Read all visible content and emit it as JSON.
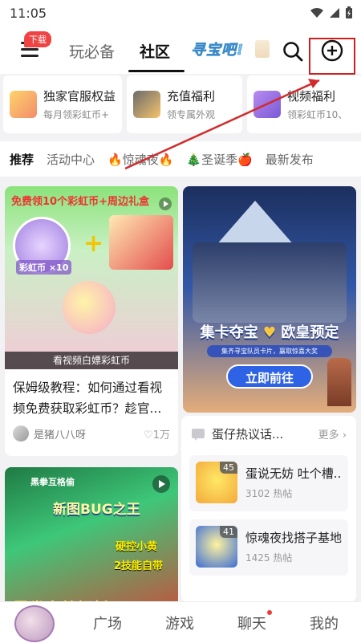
{
  "status_bar": {
    "time": "11:05"
  },
  "top_nav": {
    "download_badge": "下载",
    "tabs": [
      "玩必备",
      "社区"
    ],
    "logo_text": "寻宝吧!"
  },
  "cards": [
    {
      "title": "独家官服权益",
      "subtitle": "每月领彩虹币+"
    },
    {
      "title": "充值福利",
      "subtitle": "领专属外观"
    },
    {
      "title": "视频福利",
      "subtitle": "领彩虹币10、"
    }
  ],
  "sub_tabs": [
    "推荐",
    "活动中心",
    "🔥惊魂夜🔥",
    "🎄圣诞季🍎",
    "最新发布"
  ],
  "feed": {
    "post1": {
      "banner": "免费领10个彩虹币+周边礼盒",
      "coin_label": "彩虹币 ×10",
      "caption": "看视频白嫖彩虹币",
      "title": "保姆级教程：如何通过看视频免费获取彩虹币？趁官...",
      "author": "是猪八八呀",
      "likes": "♡1万"
    },
    "post2": {
      "headline": "集卡夺宝",
      "headline2": "欧皇预定",
      "subline": "集齐寻宝队员卡片，赢取惊喜大奖",
      "cta": "立即前往"
    },
    "post3": {
      "label": "黑拳互格偷",
      "headline": "新图BUG之王",
      "side1": "硬控小黄",
      "side2": "2技能自带",
      "bottom": "黑拳实战解析"
    },
    "discussion": {
      "title": "蛋仔热议话...",
      "more": "更多 ›",
      "topics": [
        {
          "count": "45",
          "title": "蛋说无妨 吐个槽...",
          "sub": "3102 热帖"
        },
        {
          "count": "41",
          "title": "惊魂夜找搭子基地",
          "sub": "1425 热帖"
        }
      ]
    }
  },
  "bottom_nav": [
    "广场",
    "游戏",
    "聊天",
    "我的"
  ]
}
